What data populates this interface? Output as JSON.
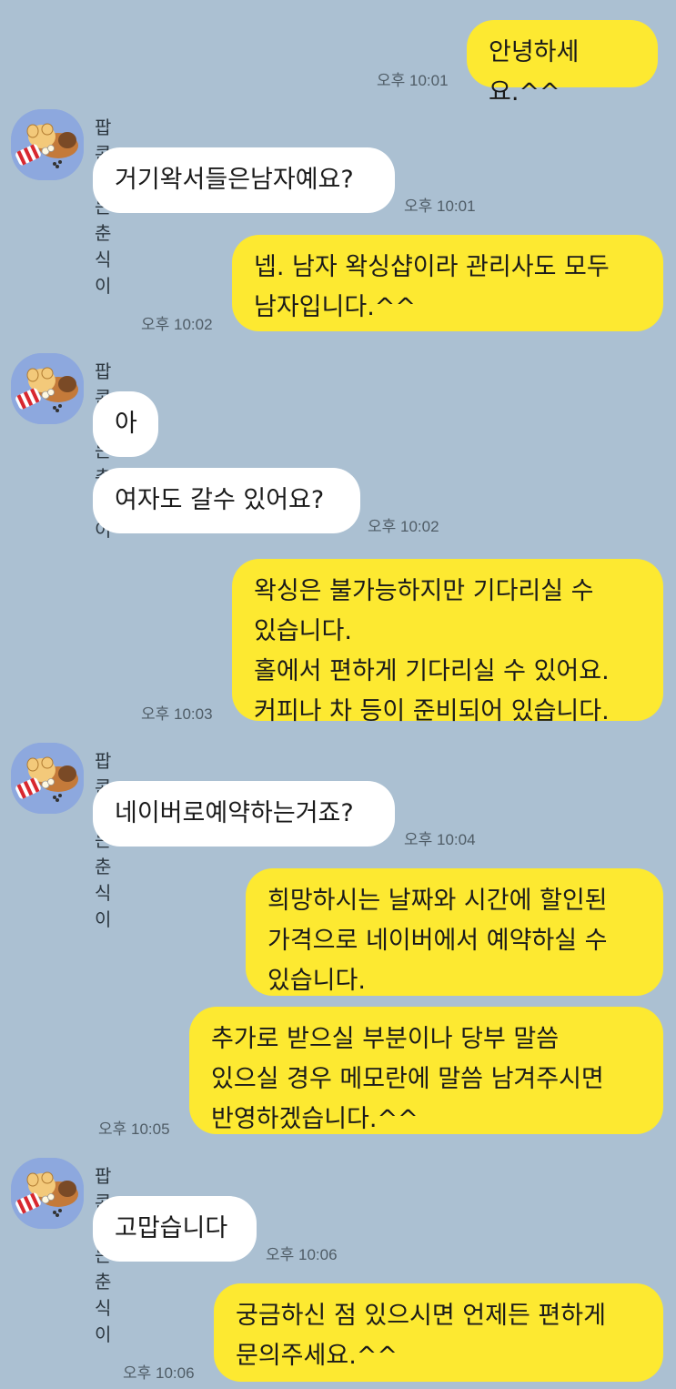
{
  "sender_name": "팝콘 먹는 춘식이",
  "messages": [
    {
      "dir": "out",
      "text": "안녕하세요.^^",
      "time": "오후 10:01"
    },
    {
      "dir": "in",
      "text": "거기왁서들은남자예요?",
      "time": "오후 10:01"
    },
    {
      "dir": "out",
      "text": "넵. 남자 왁싱샵이라 관리사도 모두\n남자입니다.^^",
      "time": "오후 10:02"
    },
    {
      "dir": "in",
      "text": "아",
      "time": ""
    },
    {
      "dir": "in",
      "text": "여자도 갈수 있어요?",
      "time": "오후 10:02"
    },
    {
      "dir": "out",
      "text": "왁싱은 불가능하지만 기다리실 수\n있습니다.\n홀에서 편하게 기다리실 수 있어요.\n커피나 차 등이 준비되어 있습니다.",
      "time": "오후 10:03"
    },
    {
      "dir": "in",
      "text": "네이버로예약하는거죠?",
      "time": "오후 10:04"
    },
    {
      "dir": "out",
      "text": "희망하시는 날짜와 시간에 할인된\n가격으로 네이버에서 예약하실 수\n있습니다.",
      "time": ""
    },
    {
      "dir": "out",
      "text": "추가로 받으실 부분이나 당부 말씀\n있으실 경우 메모란에 말씀 남겨주시면\n반영하겠습니다.^^",
      "time": "오후 10:05"
    },
    {
      "dir": "in",
      "text": "고맙습니다",
      "time": "오후 10:06"
    },
    {
      "dir": "out",
      "text": "궁금하신 점 있으시면 언제든 편하게\n문의주세요.^^",
      "time": "오후 10:06"
    }
  ],
  "colors": {
    "background": "#abc0d2",
    "outgoing_bubble": "#fde931",
    "incoming_bubble": "#ffffff",
    "avatar_bg": "#8da8de"
  },
  "avatar_icon": "popcorn-choonsik-avatar-icon"
}
